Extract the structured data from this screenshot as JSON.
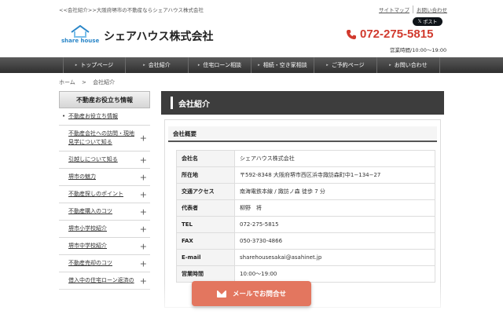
{
  "header": {
    "tagline": "<<会社紹介>>大阪府堺市の不動産ならシェアハウス株式会社",
    "links": [
      "サイトマップ",
      "お問い合わせ"
    ],
    "x_post_label": "ポスト",
    "logo_text": "share house",
    "company_name": "シェアハウス株式会社",
    "phone": "072-275-5815",
    "hours": "営業時間/10:00〜19:00"
  },
  "nav": {
    "items": [
      "トップページ",
      "会社紹介",
      "住宅ローン相談",
      "相続・空き家相談",
      "ご予約ページ",
      "お問い合わせ"
    ]
  },
  "breadcrumb": {
    "home": "ホーム",
    "sep": ">",
    "current": "会社紹介"
  },
  "sidebar": {
    "heading": "不動産お役立ち情報",
    "items": [
      "不動産お役立ち情報",
      "不動産会社への訪問・現地見学について知る",
      "引越しについて知る",
      "堺市の魅力",
      "不動産探しのポイント",
      "不動産購入のコツ",
      "堺市小学校紹介",
      "堺市中学校紹介",
      "不動産売却のコツ",
      "借入中の住宅ローン返済の"
    ]
  },
  "main": {
    "heading": "会社紹介",
    "subheading": "会社概要",
    "rows": [
      {
        "k": "会社名",
        "v": "シェアハウス株式会社"
      },
      {
        "k": "所在地",
        "v": "〒592-8348 大阪府堺市西区浜寺諏訪森町中1−134−27"
      },
      {
        "k": "交通アクセス",
        "v": "南海電鉄本線 / 諏訪ノ森 徒歩 7 分"
      },
      {
        "k": "代表者",
        "v": "柳野　将"
      },
      {
        "k": "TEL",
        "v": "072-275-5815"
      },
      {
        "k": "FAX",
        "v": "050-3730-4866"
      },
      {
        "k": "E-mail",
        "v": "sharehousesakai@asahinet.jp"
      },
      {
        "k": "営業時間",
        "v": "10:00〜19:00"
      }
    ]
  },
  "cta": {
    "mail_label": "メールでお問合せ"
  },
  "colors": {
    "accent": "#d13a2e",
    "nav": "#3d3d3d",
    "cta": "#e3765f",
    "logo": "#2a86c8"
  }
}
